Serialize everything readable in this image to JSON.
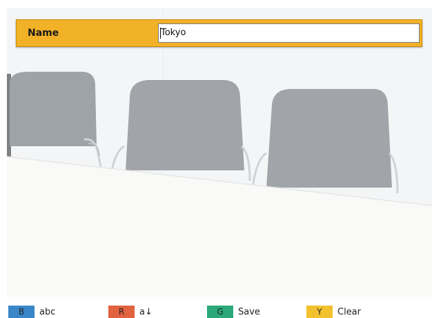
{
  "name_field": {
    "label": "Name",
    "value": "Tokyo"
  },
  "key_guide": [
    {
      "key": "B",
      "label": "abc",
      "color": "#3a86c8"
    },
    {
      "key": "R",
      "label": "a↓",
      "color": "#e0623e"
    },
    {
      "key": "G",
      "label": "Save",
      "color": "#2aa87a"
    },
    {
      "key": "Y",
      "label": "Clear",
      "color": "#f2c12e"
    }
  ],
  "colors": {
    "bar_accent": "#f2b227",
    "background": "#f0f2f3"
  }
}
